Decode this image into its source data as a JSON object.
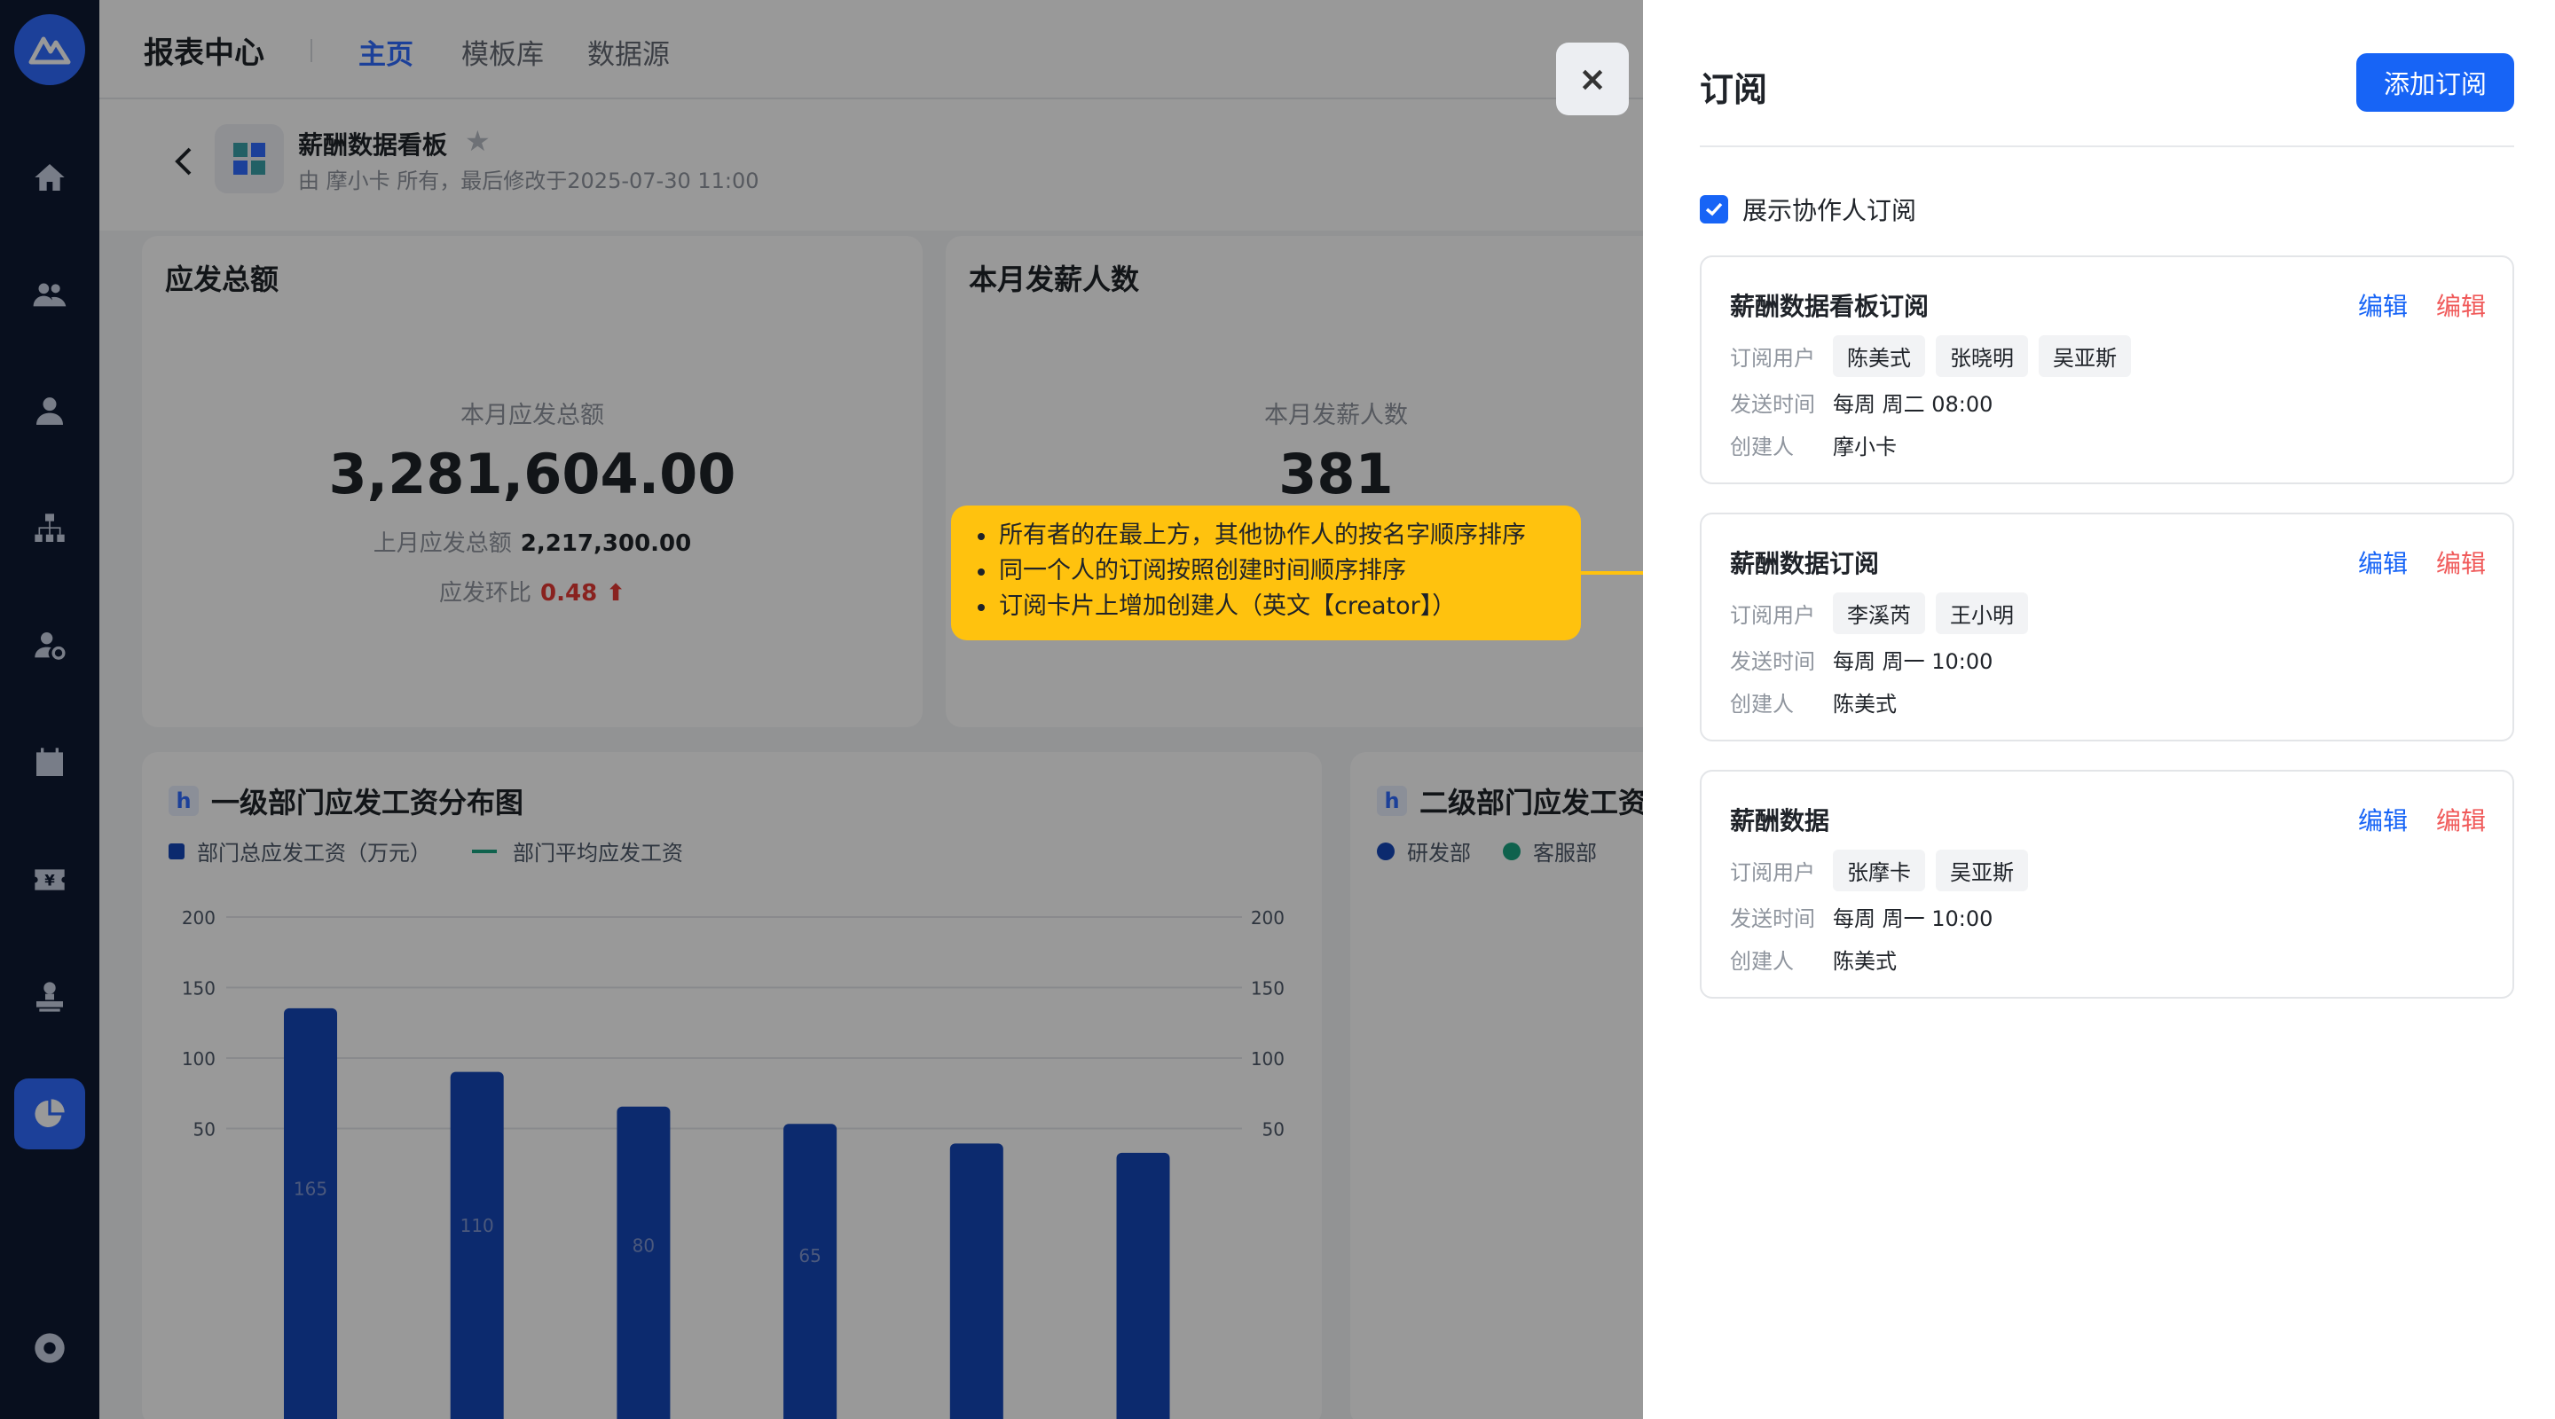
{
  "app": {
    "title": "报表中心",
    "tabs": [
      "主页",
      "模板库",
      "数据源"
    ],
    "active_tab": 0
  },
  "dashboard": {
    "name": "薪酬数据看板",
    "meta": "由 摩小卡 所有，最后修改于2025-07-30 11:00"
  },
  "kpis": [
    {
      "title": "应发总额",
      "sub": "本月应发总额",
      "value": "3,281,604.00",
      "last_label": "上月应发总额",
      "last_value": "2,217,300.00",
      "ratio_label": "应发环比",
      "ratio_value": "0.48",
      "ratio_arrow": "⬆"
    },
    {
      "title": "本月发薪人数",
      "sub": "本月发薪人数",
      "value": "381"
    }
  ],
  "charts": [
    {
      "title": "一级部门应发工资分布图",
      "legend": [
        "部门总应发工资（万元）",
        "部门平均应发工资"
      ]
    },
    {
      "title": "二级部门应发工资",
      "legend": [
        "研发部",
        "客服部"
      ]
    }
  ],
  "chart_data": {
    "type": "bar",
    "title": "一级部门应发工资分布图",
    "categories": [
      "",
      "",
      "",
      "",
      "",
      ""
    ],
    "series": [
      {
        "name": "部门总应发工资（万元）",
        "values": [
          165,
          110,
          80,
          65,
          null,
          null
        ]
      }
    ],
    "y_ticks": [
      200,
      150,
      100,
      50
    ],
    "y_right_ticks": [
      200,
      150,
      100,
      50
    ],
    "ylim": [
      0,
      200
    ],
    "colors": {
      "bar": "#1446b8",
      "avg_line": "#1aa380"
    }
  },
  "callout": {
    "lines": [
      "所有者的在最上方，其他协作人的按名字顺序排序",
      "同一个人的订阅按照创建时间顺序排序",
      "订阅卡片上增加创建人（英文【creator】）"
    ]
  },
  "drawer": {
    "title": "订阅",
    "add_label": "添加订阅",
    "show_collab_label": "展示协作人订阅",
    "close_label": "×",
    "labels": {
      "users": "订阅用户",
      "time": "发送时间",
      "creator": "创建人",
      "edit": "编辑"
    },
    "subscriptions": [
      {
        "name": "薪酬数据看板订阅",
        "users": [
          "陈美式",
          "张晓明",
          "吴亚斯"
        ],
        "time": "每周 周二 08:00",
        "creator": "摩小卡"
      },
      {
        "name": "薪酬数据订阅",
        "users": [
          "李溪芮",
          "王小明"
        ],
        "time": "每周 周一 10:00",
        "creator": "陈美式"
      },
      {
        "name": "薪酬数据",
        "users": [
          "张摩卡",
          "吴亚斯"
        ],
        "time": "每周 周一 10:00",
        "creator": "陈美式"
      }
    ]
  },
  "colors": {
    "primary": "#1764f6",
    "danger": "#f05a5a",
    "rail": "#0e1a33",
    "callout": "#ffc20e"
  }
}
